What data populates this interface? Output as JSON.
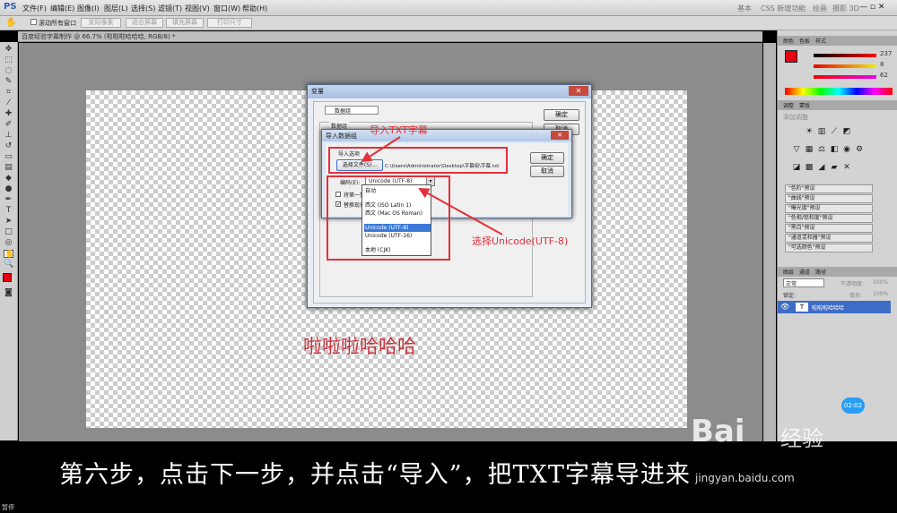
{
  "app": {
    "logo": "PS"
  },
  "menu": [
    "文件(F)",
    "编辑(E)",
    "图像(I)",
    "图层(L)",
    "选择(S)",
    "滤镜(T)",
    "视图(V)",
    "窗口(W)",
    "帮助(H)"
  ],
  "workspace": [
    "基本",
    "CSS 新增功能",
    "绘画",
    "摄影 3D"
  ],
  "options": {
    "checkbox_label": "滚动所有窗口",
    "buttons": [
      "实际像素",
      "适合屏幕",
      "填充屏幕",
      "打印尺寸"
    ]
  },
  "document": {
    "tab_title": "百度经验字幕制作 @ 66.7% (啦啦啦哈哈哈, RGB/8) *",
    "canvas_text": "啦啦啦哈哈哈"
  },
  "panels": {
    "color_tabs": [
      "颜色",
      "色板",
      "样式"
    ],
    "color_values": [
      "237",
      "8",
      "62"
    ],
    "adjust_tabs": [
      "调整",
      "蒙版"
    ],
    "adjust_header": "添加调整",
    "presets": [
      "\"色阶\"预设",
      "\"曲线\"预设",
      "\"曝光度\"预设",
      "\"色相/饱和度\"预设",
      "\"黑白\"预设",
      "\"通道混和器\"预设",
      "\"可选颜色\"预设"
    ],
    "layer_tabs": [
      "图层",
      "通道",
      "路径"
    ],
    "blend_mode": "正常",
    "opacity_label": "不透明度:",
    "opacity_value": "100%",
    "lock_label": "锁定:",
    "fill_label": "填充:",
    "fill_value": "100%",
    "layer_name": "啦啦啦哈哈哈"
  },
  "dialog_variables": {
    "title": "变量",
    "dropdown": "数据组",
    "group_label": "数据组",
    "ok": "确定",
    "cancel": "取消"
  },
  "dialog_import": {
    "title": "导入数据组",
    "section": "导入选项",
    "choose_file_btn": "选择文件(S)...",
    "file_path": "C:\\Users\\Administrator\\Desktop\\字幕组\\字幕.txt",
    "encoding_label": "编码(E):",
    "encoding_value": "Unicode (UTF-8)",
    "check1": "将第一列",
    "check2": "替换现有",
    "ok": "确定",
    "cancel": "取消",
    "encoding_options": [
      "自动",
      "西文 (ISO Latin 1)",
      "西文 (Mac OS Roman)",
      "Unicode (UTF-8)",
      "Unicode (UTF-16)",
      "本地 (CJK)"
    ],
    "selected_index": 3
  },
  "annotations": {
    "import_txt": "导入TXT字幕",
    "select_unicode": "选择Unicode(UTF-8)"
  },
  "video": {
    "time": "02:02",
    "status": "暂停"
  },
  "subtitle": "第六步，点击下一步，并点击“导入”，把TXT字幕导进来",
  "watermark": {
    "brand": "Bai",
    "brand2": "经验",
    "url": "jingyan.baidu.com"
  },
  "colors": {
    "accent_red": "#e4303a",
    "select_blue": "#3b7ad9",
    "fg_color": "#e60012"
  }
}
